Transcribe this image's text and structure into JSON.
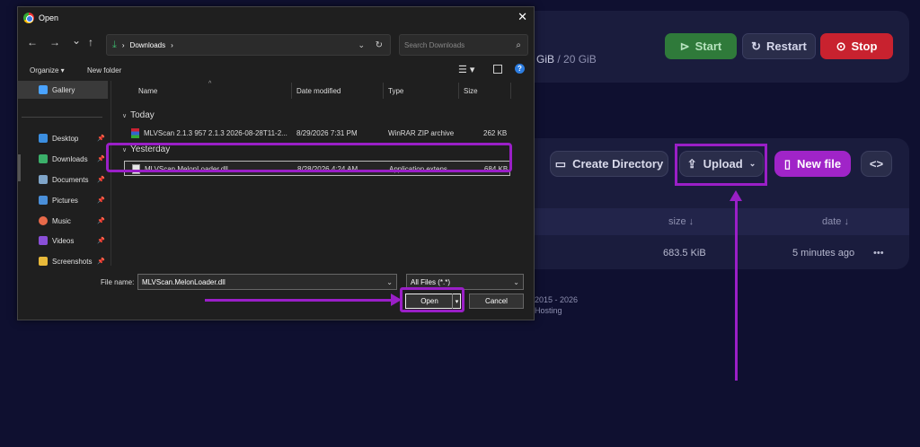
{
  "background_panel": {
    "storage_used": "GiB",
    "storage_total": "/ 20 GiB",
    "power": {
      "start": "Start",
      "restart": "Restart",
      "stop": "Stop"
    },
    "file_actions": {
      "create_directory": "Create Directory",
      "upload": "Upload",
      "new_file": "New file",
      "code_toggle": "<>"
    },
    "table": {
      "columns": [
        "size ↓",
        "date ↓"
      ],
      "row": {
        "size": "683.5 KiB",
        "date": "5 minutes ago",
        "more": "•••"
      }
    },
    "footer": {
      "copyright": "2015 - 2026",
      "hosting": "Hosting"
    },
    "colors": {
      "accent": "#9a1fc7",
      "start": "#2f7a3a",
      "stop": "#c8222f",
      "new_file": "#a024c8"
    }
  },
  "dialog": {
    "title": "Open",
    "close": "✕",
    "nav": {
      "back": "←",
      "forward": "→",
      "recent": "⌄",
      "up": "↑"
    },
    "address": {
      "path": [
        "Downloads"
      ],
      "separator": "›"
    },
    "search_placeholder": "Search Downloads",
    "toolbar": {
      "organize": "Organize ▾",
      "new_folder": "New folder",
      "help": "?"
    },
    "sidebar": [
      {
        "label": "Gallery",
        "icon": "gallery-icon",
        "color": "#4aa3ff",
        "pinned": false
      },
      {
        "label": "Desktop",
        "icon": "desktop-icon",
        "color": "#3b8ee0",
        "pinned": true
      },
      {
        "label": "Downloads",
        "icon": "downloads-icon",
        "color": "#3bb06a",
        "pinned": true
      },
      {
        "label": "Documents",
        "icon": "documents-icon",
        "color": "#7fa5c9",
        "pinned": true
      },
      {
        "label": "Pictures",
        "icon": "pictures-icon",
        "color": "#4a8fd9",
        "pinned": true
      },
      {
        "label": "Music",
        "icon": "music-icon",
        "color": "#e86a4a",
        "pinned": true
      },
      {
        "label": "Videos",
        "icon": "videos-icon",
        "color": "#8a4fd8",
        "pinned": true
      },
      {
        "label": "Screenshots",
        "icon": "folder-icon",
        "color": "#e8b93a",
        "pinned": true
      }
    ],
    "columns": {
      "name": "Name",
      "date": "Date modified",
      "type": "Type",
      "size": "Size"
    },
    "groups": [
      {
        "label": "Today",
        "files": [
          {
            "name": "MLVScan 2.1.3 957 2.1.3 2026-08-28T11-2...",
            "date": "8/29/2026 7:31 PM",
            "type": "WinRAR ZIP archive",
            "size": "262 KB",
            "icon": "zip-icon",
            "selected": false
          }
        ]
      },
      {
        "label": "Yesterday",
        "files": [
          {
            "name": "MLVScan.MelonLoader.dll",
            "date": "8/28/2026 4:24 AM",
            "type": "Application extens...",
            "size": "684 KB",
            "icon": "dll-icon",
            "selected": true
          }
        ]
      }
    ],
    "file_name_label": "File name:",
    "file_name_value": "MLVScan.MelonLoader.dll",
    "filter": "All Files (*.*)",
    "open": "Open",
    "cancel": "Cancel"
  }
}
